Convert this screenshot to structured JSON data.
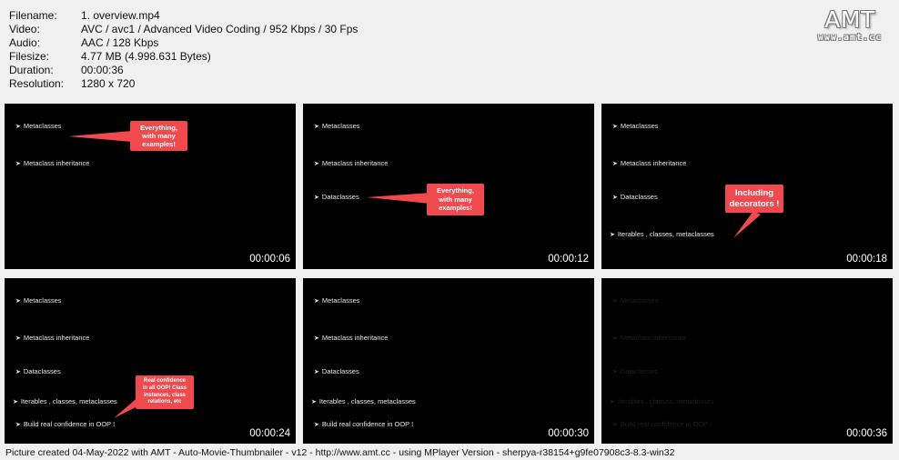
{
  "info": [
    {
      "key": "Filename:",
      "value": "1. overview.mp4"
    },
    {
      "key": "Video:",
      "value": "AVC / avc1 / Advanced Video Coding / 952 Kbps / 30 Fps"
    },
    {
      "key": "Audio:",
      "value": "AAC / 128 Kbps"
    },
    {
      "key": "Filesize:",
      "value": "4.77 MB (4.998.631 Bytes)"
    },
    {
      "key": "Duration:",
      "value": "00:00:36"
    },
    {
      "key": "Resolution:",
      "value": "1280 x 720"
    }
  ],
  "logo": {
    "main": "AMT",
    "sub": "www.amt.cc"
  },
  "bullets": {
    "metaclasses": "Metaclasses",
    "inheritance": "Metaclass inheritance",
    "dataclasses": "Dataclasses",
    "iterables": "Iterables , classes, metaclasses",
    "confidence": "Build real confidence in OOP !"
  },
  "callouts": {
    "everything": [
      "Everything,",
      "with many",
      "examples!"
    ],
    "decorators": [
      "Including",
      "decorators !"
    ],
    "confidence": [
      "Real confidence",
      "in all OOP! Class",
      "instances, class",
      "relations, etc"
    ]
  },
  "timestamps": [
    "00:00:06",
    "00:00:12",
    "00:00:18",
    "00:00:24",
    "00:00:30",
    "00:00:36"
  ],
  "footer": "Picture created 04-May-2022 with AMT - Auto-Movie-Thumbnailer - v12 - http://www.amt.cc - using MPlayer Version - sherpya-r38154+g9fe07908c3-8.3-win32",
  "colors": {
    "callout": "#f04a4f",
    "thumb_bg": "#000000",
    "page_bg": "#f0f0f0"
  }
}
